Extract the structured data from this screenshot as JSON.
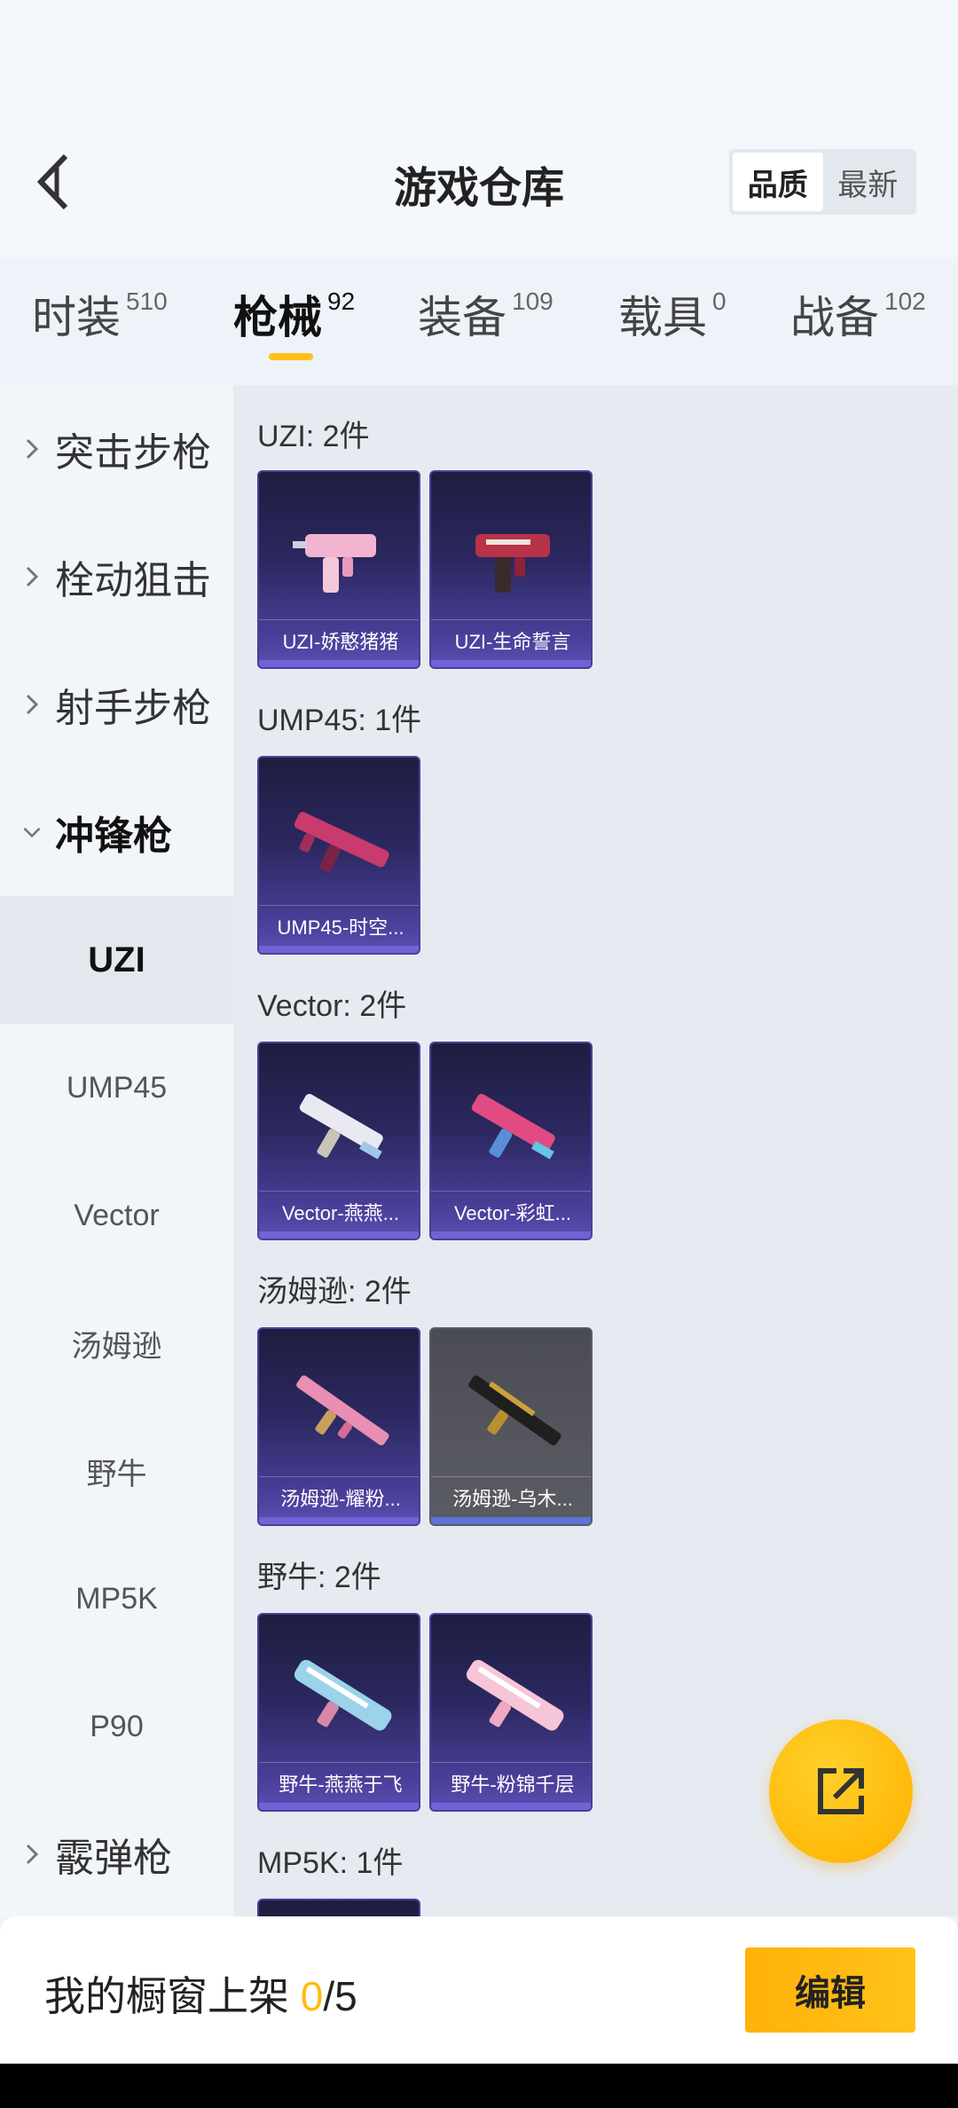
{
  "header": {
    "title": "游戏仓库",
    "sort_options": [
      "品质",
      "最新"
    ]
  },
  "tabs": [
    {
      "label": "时装",
      "count": "510"
    },
    {
      "label": "枪械",
      "count": "92"
    },
    {
      "label": "装备",
      "count": "109"
    },
    {
      "label": "载具",
      "count": "0"
    },
    {
      "label": "战备",
      "count": "102"
    }
  ],
  "sidebar": {
    "categories": [
      "突击步枪",
      "栓动狙击",
      "射手步枪",
      "冲锋枪",
      "霰弹枪"
    ],
    "subitems": [
      "UZI",
      "UMP45",
      "Vector",
      "汤姆逊",
      "野牛",
      "MP5K",
      "P90"
    ]
  },
  "groups": [
    {
      "title": "UZI: 2件",
      "items": [
        "UZI-娇憨猪猪",
        "UZI-生命誓言"
      ]
    },
    {
      "title": "UMP45: 1件",
      "items": [
        "UMP45-时空..."
      ]
    },
    {
      "title": "Vector: 2件",
      "items": [
        "Vector-燕燕...",
        "Vector-彩虹..."
      ]
    },
    {
      "title": "汤姆逊: 2件",
      "items": [
        "汤姆逊-耀粉...",
        "汤姆逊-乌木..."
      ]
    },
    {
      "title": "野牛: 2件",
      "items": [
        "野牛-燕燕于飞",
        "野牛-粉锦千层"
      ]
    },
    {
      "title": "MP5K: 1件",
      "items": []
    }
  ],
  "bottom": {
    "showcase_label": "我的橱窗上架 ",
    "showcase_current": "0",
    "showcase_total": "/5",
    "edit_label": "编辑"
  },
  "colors": {
    "accent": "#ffc018",
    "card_purple": "#4b3f9a",
    "card_gray": "#55565e"
  }
}
